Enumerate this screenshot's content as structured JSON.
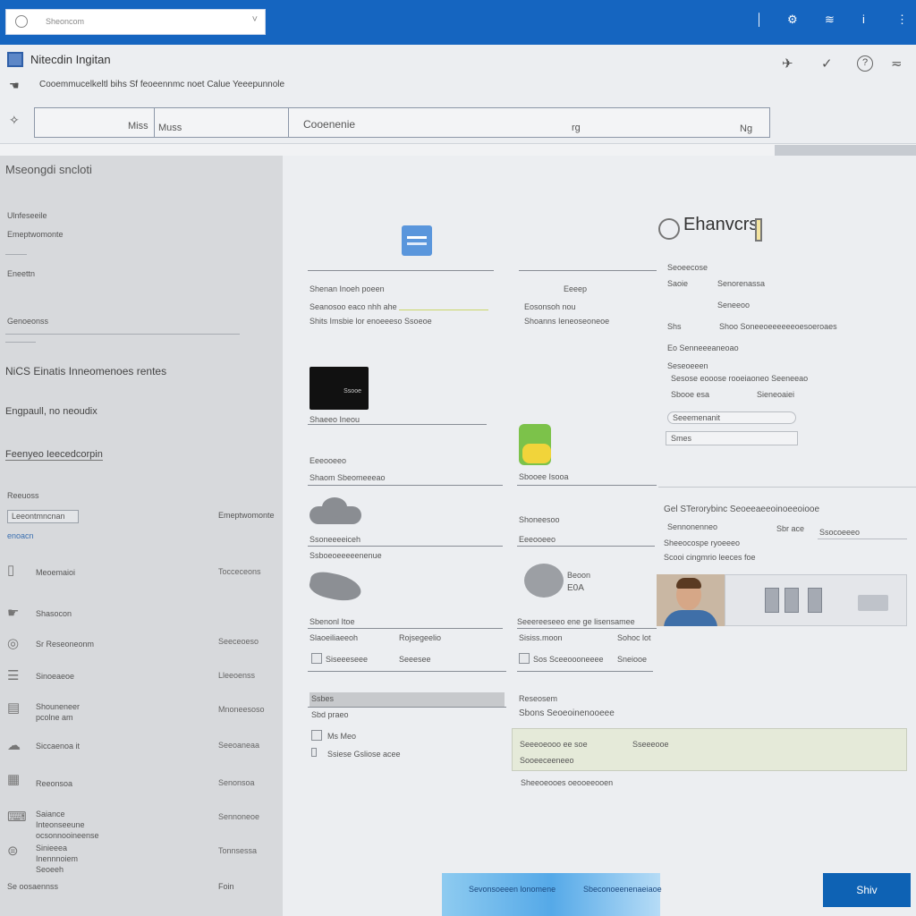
{
  "topbar": {
    "search_placeholder": "Sheoncom",
    "clear": "˅"
  },
  "app": {
    "title": "Nitecdin Ingitan",
    "crumb": "Cooemmucelkeltl bihs   Sf feoeennmc noet Calue Yeeepunnole",
    "field": {
      "a": "Miss",
      "b": "Muss",
      "c": "Cooenenie",
      "d": "rg",
      "e": "Ng"
    }
  },
  "sidebar": {
    "title": "Mseongdi sncloti",
    "sub": [
      "Ulnfeseeile",
      "Emeptwomonte",
      "Eneettn"
    ],
    "sec1": "Genoeonss",
    "heading1": "NiCS Einatis Inneomenoes rentes",
    "heading2": "Engpaull, no neoudix",
    "link": "Feenyeo Ieecedcorpin",
    "sec2": "Reeuoss",
    "input": "Leeontmncnan",
    "sub2": "enoacn",
    "items": [
      {
        "label": "Meoemaioi",
        "value": "Tocceceons"
      },
      {
        "label": "Shasocon",
        "value": ""
      },
      {
        "label": "Sr Reseoneonm",
        "value": "Seeceoeso"
      },
      {
        "label": "Sinoeaeoe",
        "value": "Lleeoenss"
      },
      {
        "label": "Shouneneer pcolne am",
        "value": "Mnoneesoso"
      },
      {
        "label": "Siccaenoa it",
        "value": "Seeoaneaa"
      },
      {
        "label": "Reeonsoa",
        "value": "Senonsoa"
      },
      {
        "label": "Saiance Inteonseeune ocsonnooineense",
        "value": "Sennoneoe"
      },
      {
        "label": "Sinieeea Inennnoiem Seoeeh",
        "value": "Tonnsessa"
      }
    ],
    "footer_label": "Se oosaennss",
    "footer_value": "Foin"
  },
  "main": {
    "brand": "Ehanvcrs",
    "col1": [
      "Shenan Inoeh poeen",
      "Seanosoo eaco nhh ahe",
      "Shits Imsbie lor enoeeeso Ssoeoe"
    ],
    "col2": [
      "Eeeep",
      "Eosonsoh nou",
      "Shoanns    Ieneoseoneoe"
    ],
    "right": [
      "Seoeecose",
      "Saoie",
      "Senorenassa",
      "Seneeoo",
      "Shs",
      "Shoo Soneeoeeeeeeoesoeroaes",
      "Eo Senneeeaneoao",
      "Seseoeeen",
      "Sesose eooose rooeiaoneo Seeneeao",
      "Sbooe esa",
      "Sieneoaiei",
      "Seeemenanit",
      "Smes"
    ],
    "card_label": "Ssooe",
    "card_caption": "Shaeeo Ineou",
    "card_sub": "Eeeooeeo",
    "wallet_label": "Sbooee Isooa",
    "pay": "Shaom Sbeomeeeao",
    "cloud_label": "Ssoneeeeiceh",
    "cloud_label2": "Shoneesoo",
    "tools": "Ssboeoeeeeenenue",
    "sticky": "Gel STerorybinc Seoeeaeeoinoeeoiooe",
    "sticky_2": "Sennonenneo",
    "sticky_3": "Sbr ace",
    "sticky_4": "Ssocoeeeo",
    "sticky_5": "Sheeocospe ryoeeeo",
    "sticky_6": "Scooi cingmrio leeces foe",
    "blob_label": "Sbenonl Itoe",
    "circle_t1": "Beoon",
    "circle_t2": "E0A",
    "circle_label": "Seeereeseeo ene ge lisensamee",
    "row1": [
      "Slaoeiliaeeoh",
      "Rojsegeelio",
      "Sisiss.moon",
      "Sohoc lot"
    ],
    "row2": [
      "Siseeeseee",
      "Seeesee",
      "Sos Sceeoooneeee",
      "Sneiooe"
    ],
    "bar": "Ssbes",
    "bar_sub": "Sbd praeo",
    "chk1": "Ms Meo",
    "chk2": "Ssiese Gsliose acee",
    "r_head": "Reseosem",
    "r_sub": "Sbons Seoeoinenooeee",
    "box1": "Seeeoeooo ee soe",
    "box2": "Sseeeooe",
    "box3": "Sooeeceeneeo",
    "box_foot": "Sheeoeooes oeooeeooen",
    "footer_btn": "Sevonsoeeen lonomene",
    "footer_btn2": "Sbeconoeenenaeiaoe",
    "save": "Shiv"
  }
}
